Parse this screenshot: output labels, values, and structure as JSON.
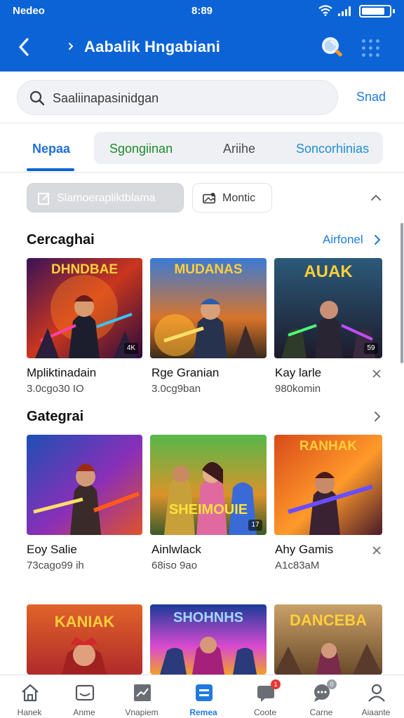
{
  "status_bar": {
    "carrier": "Nedeo",
    "time": "8:89",
    "battery_level": 0.85
  },
  "app_bar": {
    "title": "Aabalik Hngabiani"
  },
  "search": {
    "placeholder": "Saaliinapasinidgan",
    "send_label": "Snad"
  },
  "tabs": [
    {
      "label": "Nepaa",
      "active": true,
      "color": "#1f6fd6"
    },
    {
      "label": "Sgongiinan",
      "active": false,
      "color": "#1e8a2e"
    },
    {
      "label": "Ariihe",
      "active": false,
      "color": "#4a4a4d"
    },
    {
      "label": "Soncorhinias",
      "active": false,
      "color": "#1f8fd6"
    }
  ],
  "filters": [
    {
      "label": "Slamoerapliktblama",
      "icon": "edit-icon"
    },
    {
      "label": "Montic",
      "icon": "image-icon"
    }
  ],
  "sections": [
    {
      "title": "Cercaghai",
      "link": "Airfonel",
      "cards": [
        {
          "banner": "DHNDBAE",
          "title": "Mpliktinadain",
          "subtitle": "3.0cgo30 IO",
          "corner": "4K"
        },
        {
          "banner": "MUDANAS",
          "title": "Rge Granian",
          "subtitle": "3.0cg9ban",
          "corner": ""
        },
        {
          "banner": "AUAK",
          "title": "Kay larle",
          "subtitle": "980komin",
          "corner": "59"
        }
      ]
    },
    {
      "title": "Gategrai",
      "link": "",
      "cards": [
        {
          "banner": "",
          "title": "Eoy Salie",
          "subtitle": "73cago99 ih",
          "corner": ""
        },
        {
          "banner": "SHEIMOUIE",
          "title": "Ainlwlack",
          "subtitle": "68iso 9ao",
          "corner": "17"
        },
        {
          "banner": "RANHAK",
          "title": "Ahy Gamis",
          "subtitle": "A1c83aM",
          "corner": ""
        }
      ]
    },
    {
      "title": "",
      "link": "",
      "cards": [
        {
          "banner": "KANIAK",
          "title": "",
          "subtitle": "",
          "corner": ""
        },
        {
          "banner": "SHOHNHS",
          "title": "",
          "subtitle": "",
          "corner": ""
        },
        {
          "banner": "DANCEBA",
          "title": "",
          "subtitle": "",
          "corner": ""
        }
      ]
    }
  ],
  "bottom_nav": [
    {
      "label": "Hanek",
      "icon": "home-icon",
      "active": false,
      "badge": ""
    },
    {
      "label": "Anme",
      "icon": "inbox-icon",
      "active": false,
      "badge": ""
    },
    {
      "label": "Vnapiem",
      "icon": "chart-icon",
      "active": false,
      "badge": ""
    },
    {
      "label": "Remea",
      "icon": "library-icon",
      "active": true,
      "badge": ""
    },
    {
      "label": "Coote",
      "icon": "chat-icon",
      "active": false,
      "badge": "1"
    },
    {
      "label": "Carne",
      "icon": "comment-icon",
      "active": false,
      "badge": "0"
    },
    {
      "label": "Aiaante",
      "icon": "profile-icon",
      "active": false,
      "badge": ""
    }
  ],
  "colors": {
    "primary": "#0b63d6",
    "link": "#1f7ae0",
    "badge": "#e53935"
  }
}
